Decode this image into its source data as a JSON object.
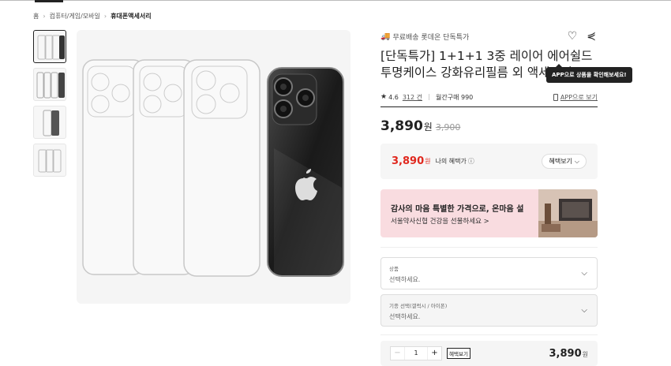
{
  "breadcrumb": [
    "홈",
    "컴퓨터/게임/모바일",
    "휴대폰액세서리"
  ],
  "product": {
    "delivery": "무료배송 롯데온 단독특가",
    "title": "[단독특가] 1+1+1 3중 레이어 에어쉴드 투명케이스 강화유리필름 외 액세서리",
    "tooltip": "APP으로 상품을 확인해보세요!",
    "rating": "4.6",
    "reviews": "312 건",
    "monthly": "월간구매 990",
    "app_link": "APP으로 보기",
    "price": "3,890",
    "price_unit": "원",
    "original_price": "3,900"
  },
  "benefit": {
    "price": "3,890",
    "unit": "원",
    "label": "나의 혜택가",
    "button": "혜택보기"
  },
  "banner": {
    "title": "감사의 마음 특별한 가격으로, 온마음 설",
    "subtitle": "서울약사신협 건강을 선물하세요 >"
  },
  "options": [
    {
      "label": "상품",
      "value": "선택하세요."
    },
    {
      "label": "기종 선택(갤럭시 / 아이폰)",
      "value": "선택하세요."
    }
  ],
  "quantity": {
    "value": "1",
    "minus": "−",
    "plus": "+",
    "benefit_tag": "혜택보기",
    "total": "3,890",
    "total_unit": "원"
  },
  "icons": {
    "heart": "heart-icon",
    "share": "share-icon",
    "star": "star-icon",
    "truck": "truck-icon"
  },
  "colors": {
    "accent_red": "#e0281e",
    "banner_bg": "#f9dce0",
    "delivery_green": "#2a8a5a"
  }
}
